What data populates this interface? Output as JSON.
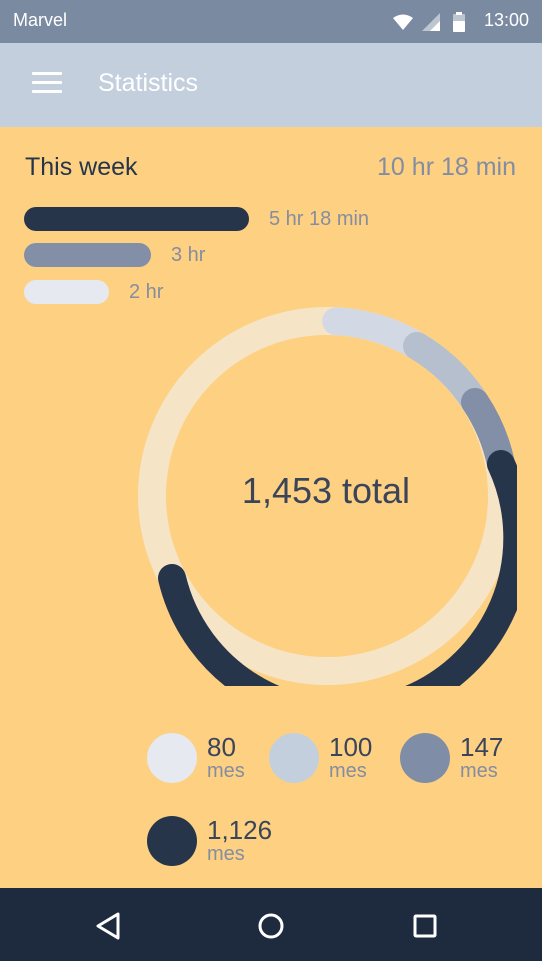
{
  "status_bar": {
    "carrier": "Marvel",
    "time": "13:00"
  },
  "app_bar": {
    "title": "Statistics"
  },
  "week": {
    "label": "This week",
    "total": "10 hr 18 min",
    "bars": [
      {
        "label": "5 hr 18 min",
        "hours": 5.3,
        "color": "#27354a"
      },
      {
        "label": "3 hr",
        "hours": 3,
        "color": "#828fa7"
      },
      {
        "label": "2 hr",
        "hours": 2,
        "color": "#e6e9f0"
      }
    ]
  },
  "donut": {
    "center_label": "1,453 total",
    "track_color": "#f5e4c6",
    "segments_color_order": [
      "#d3d9e4",
      "#b5bfcd",
      "#828fa7",
      "#27354a"
    ]
  },
  "legend": [
    {
      "value": "80",
      "unit": "mes",
      "color": "#e6e9f0"
    },
    {
      "value": "100",
      "unit": "mes",
      "color": "#c3cfdd"
    },
    {
      "value": "147",
      "unit": "mes",
      "color": "#7f8ea6"
    },
    {
      "value": "1,126",
      "unit": "mes",
      "color": "#27354a"
    }
  ],
  "icons": {
    "menu": "hamburger-icon",
    "wifi": "wifi-icon",
    "signal": "signal-icon",
    "battery": "battery-icon",
    "back": "back-triangle-icon",
    "home": "home-circle-icon",
    "recents": "recents-square-icon"
  }
}
